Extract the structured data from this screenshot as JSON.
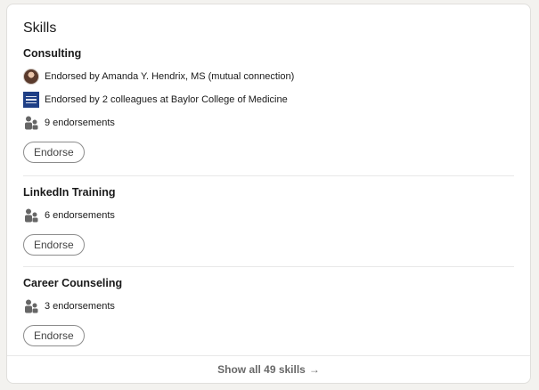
{
  "card": {
    "title": "Skills",
    "skills": [
      {
        "name": "Consulting",
        "endorsed_by_person": "Endorsed by Amanda Y. Hendrix, MS (mutual connection)",
        "endorsed_by_org": "Endorsed by 2 colleagues at Baylor College of Medicine",
        "endorsements": "9 endorsements",
        "button": "Endorse"
      },
      {
        "name": "LinkedIn Training",
        "endorsements": "6 endorsements",
        "button": "Endorse"
      },
      {
        "name": "Career Counseling",
        "endorsements": "3 endorsements",
        "button": "Endorse"
      }
    ],
    "footer": {
      "label": "Show all 49 skills",
      "arrow": "→"
    }
  }
}
